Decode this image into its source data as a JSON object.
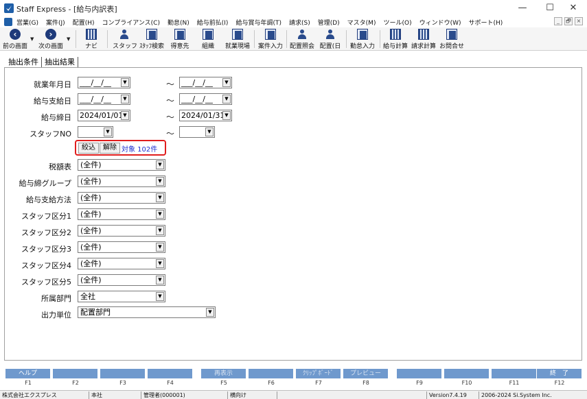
{
  "window": {
    "title": "Staff Express - [給与内訳表]",
    "minimize": "—",
    "maximize": "☐",
    "close": "✕"
  },
  "menu": {
    "items": [
      "営業(G)",
      "案件(J)",
      "配置(H)",
      "コンプライアンス(C)",
      "勤怠(N)",
      "給与前払(I)",
      "給与賞与年調(T)",
      "請求(S)",
      "管理(D)",
      "マスタ(M)",
      "ツール(O)",
      "ウィンドウ(W)",
      "サポート(H)"
    ],
    "mdi": [
      "_",
      "🗗",
      "×"
    ]
  },
  "toolbar": {
    "back": "前の画面",
    "forward": "次の画面",
    "navi": "ナビ",
    "staff": "スタッフ",
    "staff_search": "ｽﾀｯﾌ検索",
    "client": "得意先",
    "org": "組織",
    "worksite": "就業現場",
    "case_input": "案件入力",
    "assign_inquiry": "配置照会",
    "assign": "配置(日",
    "attendance_input": "勤怠入力",
    "payroll_calc": "給与計算",
    "billing_calc": "請求計算",
    "contact": "お問合せ"
  },
  "tabs": [
    "抽出条件",
    "抽出結果"
  ],
  "form": {
    "tilde": "～",
    "employment_date": {
      "label": "就業年月日",
      "from": "___/__/__",
      "to": "___/__/__"
    },
    "pay_date": {
      "label": "給与支給日",
      "from": "___/__/__",
      "to": "___/__/__"
    },
    "closing_date": {
      "label": "給与締日",
      "from": "2024/01/01",
      "to": "2024/01/31"
    },
    "staff_no": {
      "label": "スタッフNO",
      "from": "",
      "to": ""
    },
    "filter": {
      "apply": "絞込",
      "clear": "解除",
      "count": "対象 102件"
    },
    "tax_table": {
      "label": "税額表",
      "value": "(全件)"
    },
    "closing_group": {
      "label": "給与締グループ",
      "value": "(全件)"
    },
    "payment_method": {
      "label": "給与支給方法",
      "value": "(全件)"
    },
    "staff_class1": {
      "label": "スタッフ区分1",
      "value": "(全件)"
    },
    "staff_class2": {
      "label": "スタッフ区分2",
      "value": "(全件)"
    },
    "staff_class3": {
      "label": "スタッフ区分3",
      "value": "(全件)"
    },
    "staff_class4": {
      "label": "スタッフ区分4",
      "value": "(全件)"
    },
    "staff_class5": {
      "label": "スタッフ区分5",
      "value": "(全件)"
    },
    "department": {
      "label": "所属部門",
      "value": "全社"
    },
    "output_unit": {
      "label": "出力単位",
      "value": "配置部門"
    }
  },
  "fkeys": [
    {
      "key": "F1",
      "label": "ヘルプ"
    },
    {
      "key": "F2",
      "label": ""
    },
    {
      "key": "F3",
      "label": ""
    },
    {
      "key": "F4",
      "label": ""
    },
    {
      "key": "F5",
      "label": "再表示"
    },
    {
      "key": "F6",
      "label": ""
    },
    {
      "key": "F7",
      "label": "ｸﾘｯﾌﾟﾎﾞｰﾄﾞ"
    },
    {
      "key": "F8",
      "label": "プレビュー"
    },
    {
      "key": "F9",
      "label": ""
    },
    {
      "key": "F10",
      "label": ""
    },
    {
      "key": "F11",
      "label": ""
    },
    {
      "key": "F12",
      "label": "終　了"
    }
  ],
  "status": {
    "company": "株式会社エクスプレス",
    "branch": "本社",
    "user": "管理者(000001)",
    "orientation": "横向け",
    "blank": "",
    "version": "Version7.4.19",
    "copyright": "2006-2024 Si.System Inc."
  }
}
